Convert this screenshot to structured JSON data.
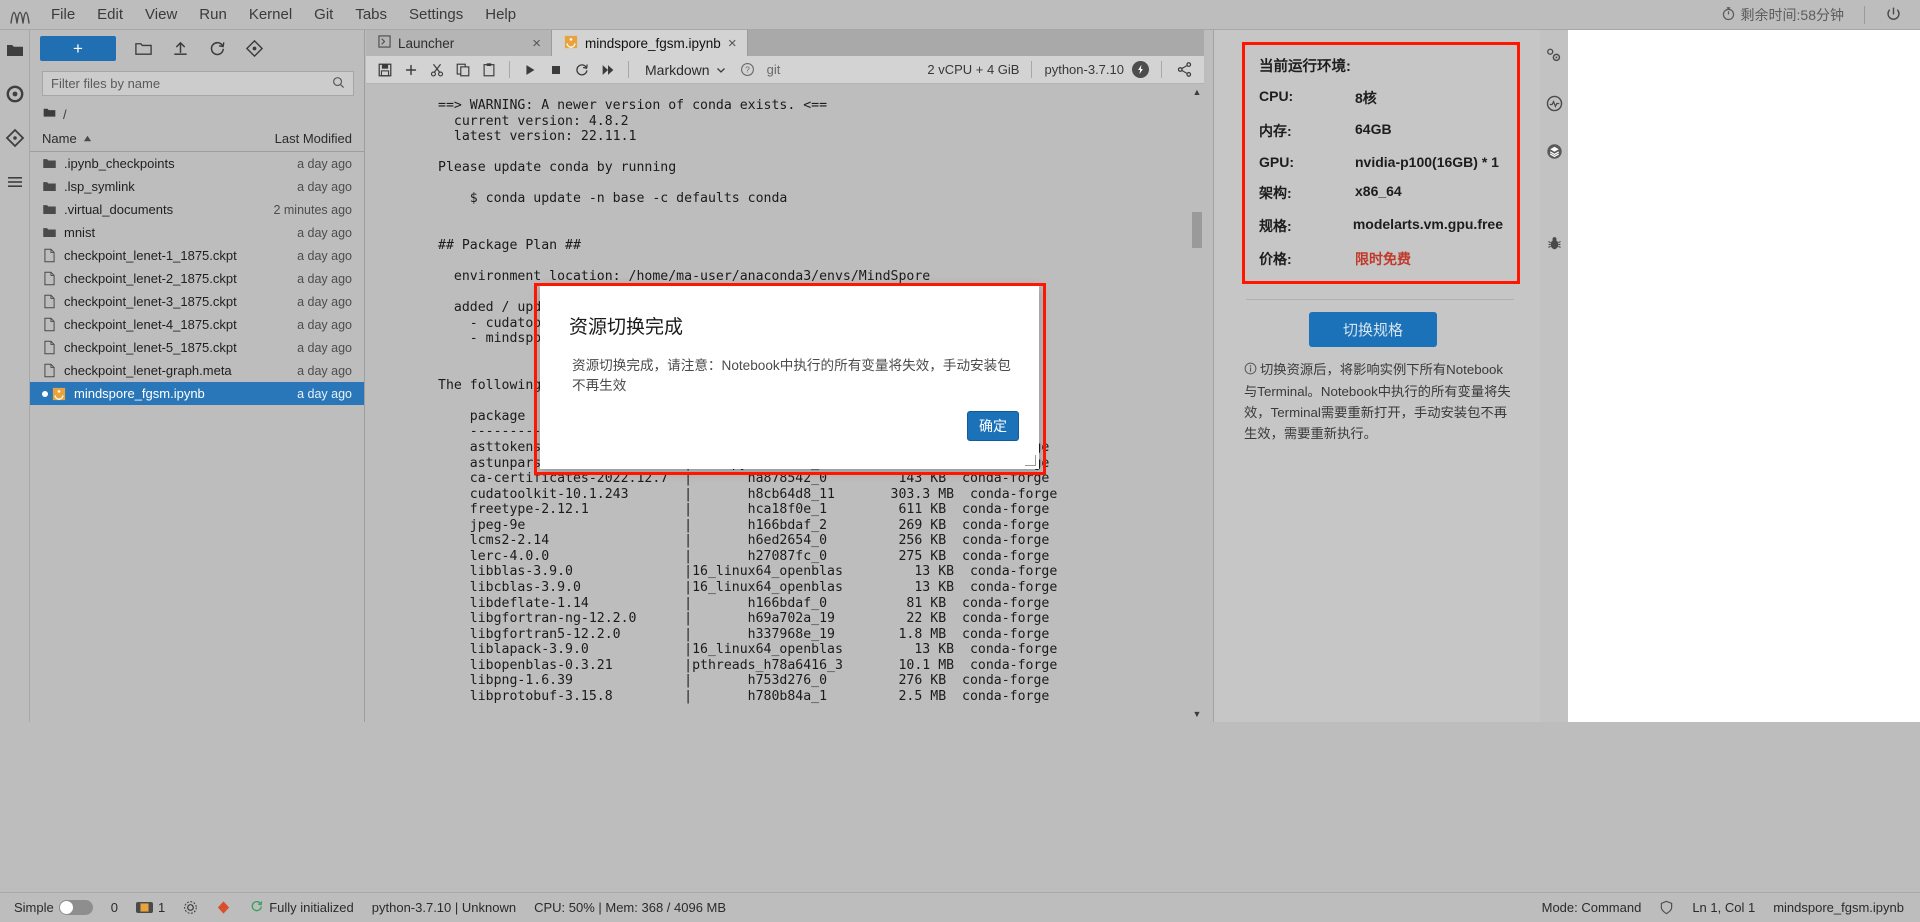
{
  "menubar": {
    "logo": "jupyter-logo",
    "items": [
      "File",
      "Edit",
      "View",
      "Run",
      "Kernel",
      "Git",
      "Tabs",
      "Settings",
      "Help"
    ],
    "timer_label": "剩余时间:58分钟",
    "timer_icon": "stopwatch-icon",
    "power_icon": "power-icon"
  },
  "left_rail": {
    "icons": [
      "folder-icon",
      "running-terminals-icon",
      "git-icon",
      "table-of-contents-icon"
    ]
  },
  "filebrowser": {
    "new_button": "+",
    "toolbar_icons": [
      "new-folder-icon",
      "upload-icon",
      "refresh-icon",
      "new-launcher-icon"
    ],
    "filter_placeholder": "Filter files by name",
    "search_icon": "search-icon",
    "breadcrumb": "/",
    "columns": {
      "name": "Name",
      "modified": "Last Modified"
    },
    "sort_icon": "sort-ascending-icon",
    "rows": [
      {
        "name": ".ipynb_checkpoints",
        "modified": "a day ago",
        "type": "folder",
        "selected": false
      },
      {
        "name": ".lsp_symlink",
        "modified": "a day ago",
        "type": "folder",
        "selected": false
      },
      {
        "name": ".virtual_documents",
        "modified": "2 minutes ago",
        "type": "folder",
        "selected": false
      },
      {
        "name": "mnist",
        "modified": "a day ago",
        "type": "folder",
        "selected": false
      },
      {
        "name": "checkpoint_lenet-1_1875.ckpt",
        "modified": "a day ago",
        "type": "file",
        "selected": false
      },
      {
        "name": "checkpoint_lenet-2_1875.ckpt",
        "modified": "a day ago",
        "type": "file",
        "selected": false
      },
      {
        "name": "checkpoint_lenet-3_1875.ckpt",
        "modified": "a day ago",
        "type": "file",
        "selected": false
      },
      {
        "name": "checkpoint_lenet-4_1875.ckpt",
        "modified": "a day ago",
        "type": "file",
        "selected": false
      },
      {
        "name": "checkpoint_lenet-5_1875.ckpt",
        "modified": "a day ago",
        "type": "file",
        "selected": false
      },
      {
        "name": "checkpoint_lenet-graph.meta",
        "modified": "a day ago",
        "type": "file",
        "selected": false
      },
      {
        "name": "mindspore_fgsm.ipynb",
        "modified": "a day ago",
        "type": "notebook",
        "selected": true
      }
    ]
  },
  "main": {
    "tabs": [
      {
        "label": "Launcher",
        "icon": "launcher-icon",
        "active": false
      },
      {
        "label": "mindspore_fgsm.ipynb",
        "icon": "notebook-icon",
        "active": true
      }
    ],
    "notebook_toolbar": {
      "icons": [
        "save-icon",
        "insert-cell-icon",
        "cut-icon",
        "copy-icon",
        "paste-icon",
        "run-icon",
        "stop-icon",
        "restart-icon",
        "restart-run-all-icon"
      ],
      "cell_type": "Markdown",
      "chevron_icon": "chevron-down-icon",
      "help_icon": "question-icon",
      "git_label": "git",
      "resource_label": "2 vCPU + 4 GiB",
      "kernel_label": "python-3.7.10",
      "kernel_status_icon": "kernel-busy-icon",
      "share_icon": "share-icon"
    },
    "output_text": "==> WARNING: A newer version of conda exists. <==\n  current version: 4.8.2\n  latest version: 22.11.1\n\nPlease update conda by running\n\n    $ conda update -n base -c defaults conda\n\n\n## Package Plan ##\n\n  environment location: /home/ma-user/anaconda3/envs/MindSpore\n\n  added / updated specs:\n    - cudatoolkit=10.1\n    - mindspore-gpu=1.7.0\n\n\nThe following packages will be downloaded:\n\n    package                    |            build\n    ---------------------------|-----------------\n    asttokens-2.2.1            |     pyhd8ed1ab_0          27 KB  conda-forge\n    astunparse-1.6.3           |     pyhd8ed1ab_0          15 KB  conda-forge\n    ca-certificates-2022.12.7  |       ha878542_0         143 KB  conda-forge\n    cudatoolkit-10.1.243       |       h8cb64d8_11       303.3 MB  conda-forge\n    freetype-2.12.1            |       hca18f0e_1         611 KB  conda-forge\n    jpeg-9e                    |       h166bdaf_2         269 KB  conda-forge\n    lcms2-2.14                 |       h6ed2654_0         256 KB  conda-forge\n    lerc-4.0.0                 |       h27087fc_0         275 KB  conda-forge\n    libblas-3.9.0              |16_linux64_openblas         13 KB  conda-forge\n    libcblas-3.9.0             |16_linux64_openblas         13 KB  conda-forge\n    libdeflate-1.14            |       h166bdaf_0          81 KB  conda-forge\n    libgfortran-ng-12.2.0      |       h69a702a_19         22 KB  conda-forge\n    libgfortran5-12.2.0        |       h337968e_19        1.8 MB  conda-forge\n    liblapack-3.9.0            |16_linux64_openblas         13 KB  conda-forge\n    libopenblas-0.3.21         |pthreads_h78a6416_3       10.1 MB  conda-forge\n    libpng-1.6.39              |       h753d276_0         276 KB  conda-forge\n    libprotobuf-3.15.8         |       h780b84a_1         2.5 MB  conda-forge"
  },
  "right_panel": {
    "env_title": "当前运行环境:",
    "env_rows": [
      {
        "key": "CPU:",
        "value": "8核",
        "accent": false
      },
      {
        "key": "内存:",
        "value": "64GB",
        "accent": false
      },
      {
        "key": "GPU:",
        "value": "nvidia-p100(16GB) * 1",
        "accent": false
      },
      {
        "key": "架构:",
        "value": "x86_64",
        "accent": false
      },
      {
        "key": "规格:",
        "value": "modelarts.vm.gpu.free",
        "accent": false
      },
      {
        "key": "价格:",
        "value": "限时免费",
        "accent": true
      }
    ],
    "switch_button": "切换规格",
    "info_icon": "info-circle-icon",
    "note": "切换资源后，将影响实例下所有Notebook与Terminal。Notebook中执行的所有变量将失效，Terminal需要重新打开，手动安装包不再生效，需要重新执行。"
  },
  "far_rail": {
    "icons": [
      "settings-gear-icon",
      "monitor-icon",
      "layers-icon",
      "debug-bug-icon"
    ]
  },
  "modal": {
    "title": "资源切换完成",
    "message": "资源切换完成，请注意：Notebook中执行的所有变量将失效，手动安装包不再生效",
    "ok_label": "确定",
    "resize_grip": "resize-grip-icon"
  },
  "statusbar": {
    "simple_label": "Simple",
    "toggle_state": "off",
    "terminal_count": "0",
    "kernel_count": "1",
    "kernel_badge_icon": "notebook-kernel-icon",
    "settings_icon": "gear-icon",
    "git_branch_icon": "git-branch-icon",
    "init_icon": "sync-icon",
    "init_label": "Fully initialized",
    "kernel_name": "python-3.7.10 | Unknown",
    "resource_usage": "CPU: 50% | Mem: 368 / 4096 MB",
    "mode": "Mode: Command",
    "shield_icon": "shield-icon",
    "cursor_position": "Ln 1, Col 1",
    "filename": "mindspore_fgsm.ipynb"
  },
  "colors": {
    "accent_blue": "#1b72b8",
    "highlight_red": "#ff1500",
    "price_red": "#c0392b",
    "selection_blue": "#2977b8"
  }
}
